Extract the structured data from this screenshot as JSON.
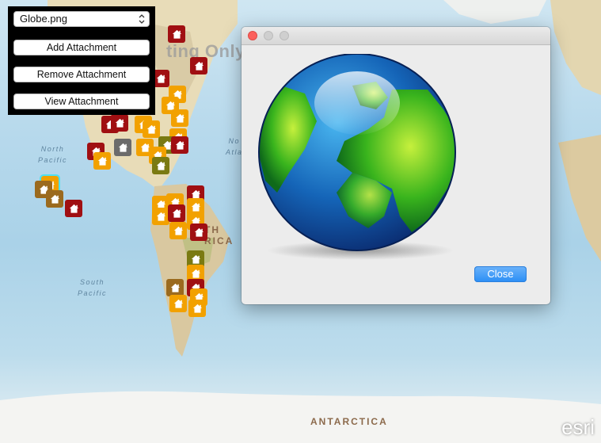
{
  "map": {
    "watermark": "ting Only",
    "labels": {
      "north_pacific": "North\nPacific",
      "north_atlantic": "No\nAtla",
      "south_pacific": "South\nPacific",
      "antarctica": "ANTARCTICA",
      "south_america": "TH\nRICA"
    },
    "attribution": "esri",
    "pin_colors": {
      "dark_red": "#a00f12",
      "orange": "#f2a100",
      "olive": "#7a7a12",
      "gray": "#6b6b6b",
      "brown": "#9b6a1e"
    },
    "highlight_color": "#4fe0f0",
    "pin_icon": "house-icon"
  },
  "panel": {
    "attachment_select_value": "Globe.png",
    "add_label": "Add Attachment",
    "remove_label": "Remove Attachment",
    "view_label": "View Attachment"
  },
  "dialog": {
    "image_content": "globe-image",
    "close_label": "Close",
    "accent_color": "#2a8ef5"
  }
}
